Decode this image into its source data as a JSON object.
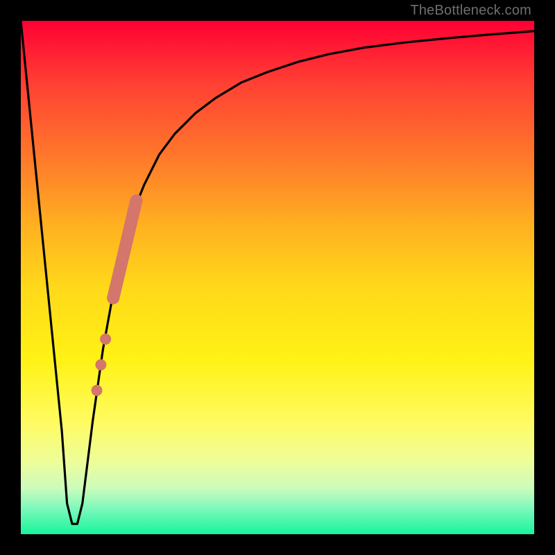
{
  "watermark": "TheBottleneck.com",
  "chart_data": {
    "type": "line",
    "title": "",
    "xlabel": "",
    "ylabel": "",
    "xlim": [
      0,
      100
    ],
    "ylim": [
      0,
      100
    ],
    "grid": false,
    "series": [
      {
        "name": "curve",
        "x": [
          0,
          2,
          4,
          6,
          8,
          9,
          10,
          11,
          12,
          14,
          16,
          18,
          20,
          22,
          24,
          27,
          30,
          34,
          38,
          43,
          48,
          54,
          60,
          67,
          75,
          83,
          91,
          100
        ],
        "y": [
          100,
          80,
          60,
          40,
          20,
          6,
          2,
          2,
          6,
          22,
          36,
          47,
          56,
          63,
          68,
          74,
          78,
          82,
          85,
          88,
          90,
          92,
          93.5,
          94.8,
          95.8,
          96.6,
          97.3,
          98
        ]
      }
    ],
    "highlight_segment": {
      "name": "highlight",
      "color": "#d4766b",
      "points_x": [
        14.8,
        15.6,
        16.5,
        18.0,
        22.5
      ],
      "points_y": [
        28.0,
        33.0,
        38.0,
        46.0,
        65.0
      ],
      "thick_from_index": 3
    },
    "colors": {
      "curve": "#000000",
      "highlight": "#d4766b",
      "frame": "#000000",
      "gradient_top": "#ff0033",
      "gradient_bottom": "#17f59c"
    }
  }
}
